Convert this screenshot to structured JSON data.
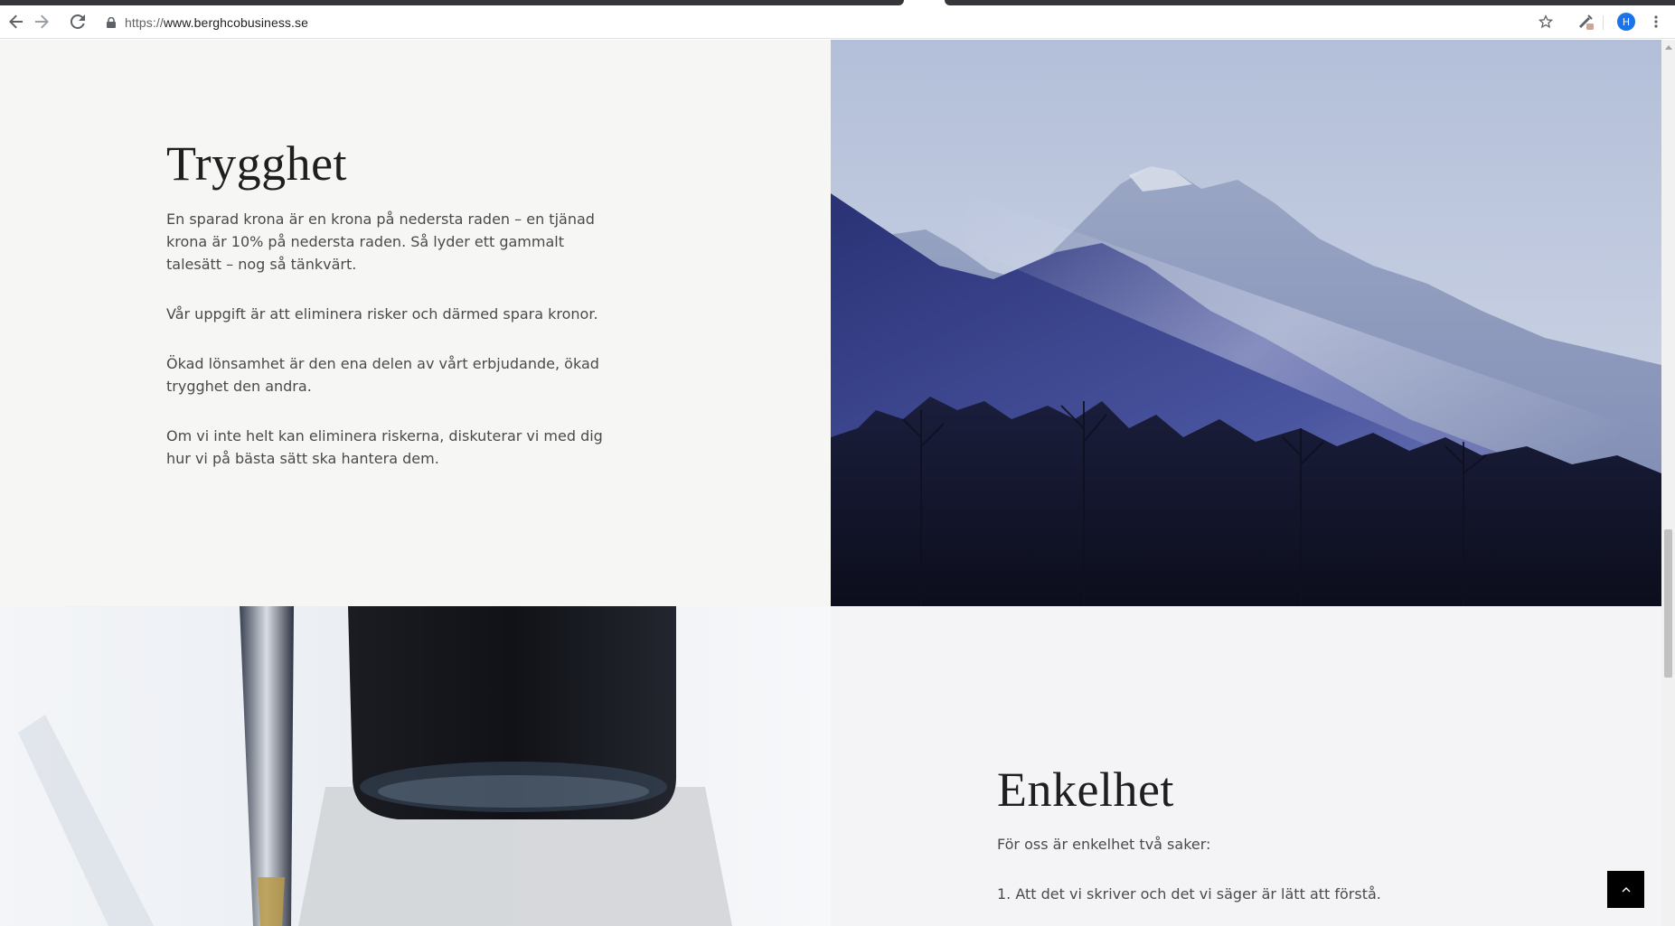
{
  "browser": {
    "url_scheme": "https://",
    "url_host": "www.berghcobusiness.se",
    "profile_initial": "H",
    "icons": [
      "back-arrow-icon",
      "forward-arrow-icon",
      "reload-icon",
      "lock-icon",
      "star-icon",
      "extension-icon",
      "kebab-menu-icon"
    ]
  },
  "section_trygghet": {
    "heading": "Trygghet",
    "paragraphs": [
      "En sparad krona är en krona på nedersta raden – en tjänad krona är 10% på nedersta raden. Så lyder ett gammalt talesätt – nog så tänkvärt.",
      "Vår uppgift är att eliminera risker och därmed spara kronor.",
      "Ökad lönsamhet är den ena delen av vårt erbjudande, ökad trygghet den andra.",
      "Om vi inte helt kan eliminera riskerna, diskuterar vi med dig hur vi på bästa sätt ska hantera dem."
    ]
  },
  "section_enkelhet": {
    "heading": "Enkelhet",
    "paragraphs": [
      "För oss är enkelhet två saker:",
      "1. Att det vi skriver och det vi säger är lätt att förstå."
    ]
  },
  "colors": {
    "panel_light": "#f6f6f4",
    "panel_light_2": "#f4f4f6",
    "mountain_sky": "#b8c3dc",
    "mountain_dark": "#1c2150",
    "back_to_top_bg": "#000000"
  },
  "images": [
    "mountain-landscape-image",
    "ink-bottle-pen-image"
  ],
  "controls": {
    "back_to_top_icon": "chevron-up-icon"
  }
}
